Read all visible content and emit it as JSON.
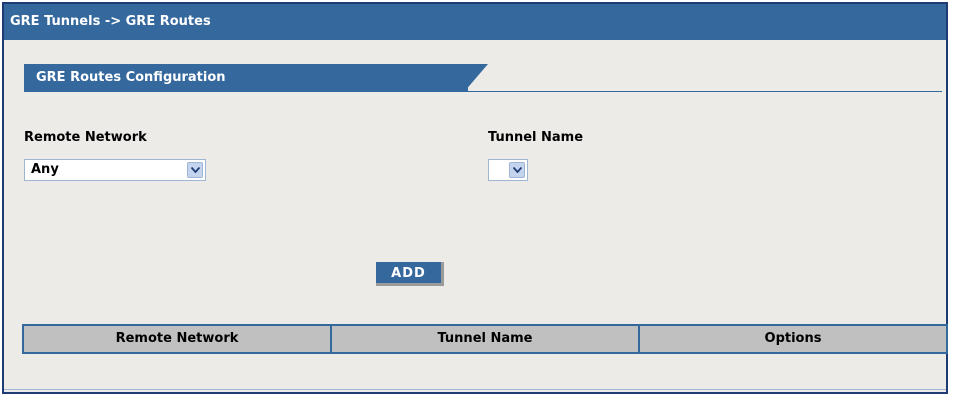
{
  "breadcrumb": {
    "text": "GRE Tunnels  -> GRE Routes"
  },
  "section": {
    "title": "GRE Routes Configuration"
  },
  "form": {
    "remote_network": {
      "label": "Remote Network",
      "selected": "Any"
    },
    "tunnel_name": {
      "label": "Tunnel Name",
      "selected": ""
    },
    "add_label": "ADD"
  },
  "table": {
    "headers": [
      "Remote Network",
      "Tunnel Name",
      "Options"
    ]
  },
  "colors": {
    "accent": "#35699e",
    "background": "#ecebe8",
    "header_cell": "#c0c0c0"
  },
  "icons": {
    "dropdown": "chevron-down-icon"
  }
}
